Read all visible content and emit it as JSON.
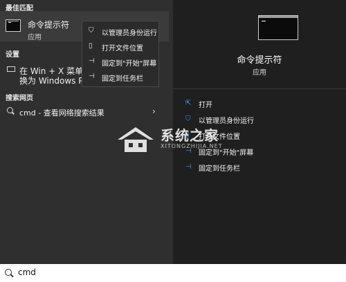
{
  "left_panel": {
    "best_match_title": "最佳匹配",
    "best_match_item": {
      "title": "命令提示符",
      "subtitle": "应用",
      "icon": "terminal-icon"
    },
    "settings_title": "设置",
    "settings_item": {
      "line1": "在 Win + X 菜单中",
      "line2": "换为 Windows Pov",
      "icon": "laptop-icon"
    },
    "search_web_title": "搜索网页",
    "search_web_item": {
      "label": "cmd - 查看网络搜索结果",
      "chevron": "›",
      "icon": "search-icon"
    }
  },
  "context_menu": {
    "items": [
      {
        "label": "以管理员身份运行",
        "icon": "shield-icon"
      },
      {
        "label": "打开文件位置",
        "icon": "file-icon"
      },
      {
        "label": "固定到\"开始\"屏幕",
        "icon": "pin-icon"
      },
      {
        "label": "固定到任务栏",
        "icon": "pin-icon"
      }
    ]
  },
  "right_panel": {
    "title": "命令提示符",
    "subtitle": "应用",
    "icon": "terminal-icon",
    "actions": [
      {
        "label": "打开",
        "icon": "open-icon"
      },
      {
        "label": "以管理员身份运行",
        "icon": "shield-icon"
      },
      {
        "label": "打开文件位置",
        "icon": "file-icon"
      },
      {
        "label": "固定到\"开始\"屏幕",
        "icon": "pin-icon"
      },
      {
        "label": "固定到任务栏",
        "icon": "pin-icon"
      }
    ]
  },
  "search_bar": {
    "value": "cmd",
    "icon": "search-icon"
  },
  "watermark": {
    "text": "系统之家",
    "subtext": "XITONGZHIJIA.NET"
  },
  "colors": {
    "left_bg": "#2f2f2f",
    "right_bg": "#1f1f1f",
    "accent": "#3aa0ff",
    "searchbar_bg": "#ffffff"
  }
}
